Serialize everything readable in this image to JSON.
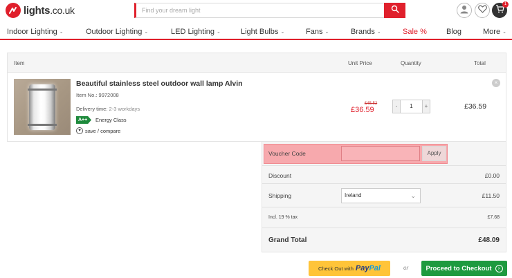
{
  "header": {
    "logo_text": "lights",
    "logo_domain": ".co.uk",
    "search_placeholder": "Find your dream light",
    "cart_count": "1"
  },
  "nav": {
    "items": [
      {
        "label": "Indoor Lighting",
        "chevron": true
      },
      {
        "label": "Outdoor Lighting",
        "chevron": true
      },
      {
        "label": "LED Lighting",
        "chevron": true
      },
      {
        "label": "Light Bulbs",
        "chevron": true
      },
      {
        "label": "Fans",
        "chevron": true
      },
      {
        "label": "Brands",
        "chevron": true
      },
      {
        "label": "Sale %",
        "chevron": false
      },
      {
        "label": "Blog",
        "chevron": false
      },
      {
        "label": "More",
        "chevron": true
      }
    ],
    "accent_color": "#e0202c"
  },
  "cart": {
    "columns": {
      "item": "Item",
      "unit_price": "Unit Price",
      "quantity": "Quantity",
      "total": "Total"
    },
    "product": {
      "title": "Beautiful stainless steel outdoor wall lamp Alvin",
      "item_no_label": "Item No.:",
      "item_no": "9972008",
      "delivery_label": "Delivery time:",
      "delivery_value": "2-3 workdays",
      "energy_rating": "A++",
      "energy_label": "Energy Class",
      "save_label": "save / compare",
      "old_price": "£45.52",
      "price": "£36.59",
      "quantity": "1",
      "qty_minus": "-",
      "qty_plus": "+",
      "line_total": "£36.59",
      "remove": "×"
    }
  },
  "summary": {
    "voucher_label": "Voucher Code",
    "voucher_value": "",
    "apply_label": "Apply",
    "discount_label": "Discount",
    "discount_value": "£0.00",
    "shipping_label": "Shipping",
    "shipping_country": "Ireland",
    "shipping_value": "£11.50",
    "tax_label": "Incl. 19 % tax",
    "tax_value": "£7.68",
    "grand_total_label": "Grand Total",
    "grand_total_value": "£48.09"
  },
  "checkout": {
    "paypal_prefix": "Check Out with",
    "paypal_pay": "Pay",
    "paypal_pal": "Pal",
    "or_label": "or",
    "proceed_label": "Proceed to Checkout",
    "proceed_color": "#1e9a3f",
    "paypal_color": "#ffc439"
  }
}
